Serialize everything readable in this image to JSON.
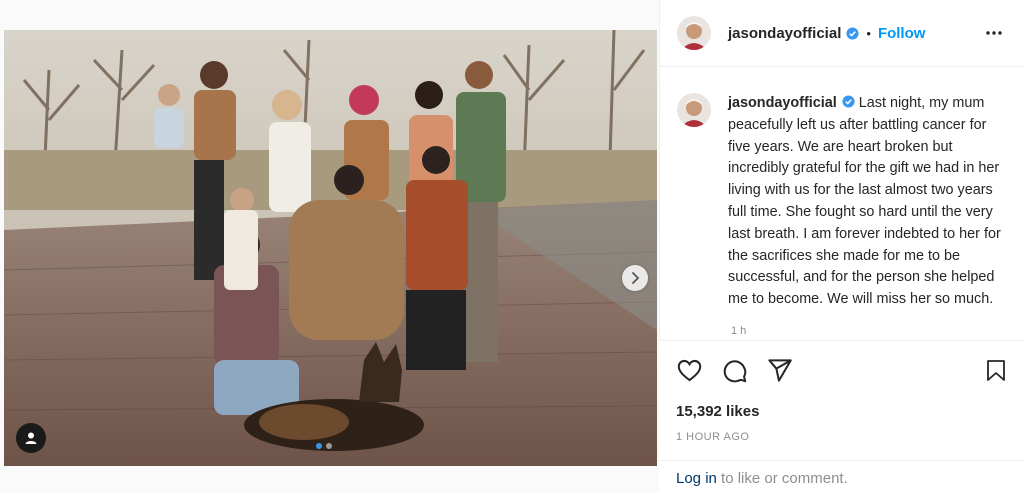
{
  "post": {
    "username": "jasondayofficial",
    "follow_label": "Follow",
    "separator": "•",
    "caption": "Last night, my mum peacefully left us after battling cancer for five years. We are heart broken but incredibly grateful for the gift we had in her living with us for the last almost two years full time. She fought so hard until the very last breath. I am forever indebted to her for the sacrifices she made for me to be successful, and for the person she helped me to become. We will miss her so much.",
    "relative_time": "1 h",
    "likes": "15,392 likes",
    "posted_ago": "1 HOUR AGO"
  },
  "login": {
    "link": "Log in",
    "rest": " to like or comment."
  },
  "carousel": {
    "slide_count": 2,
    "active_slide": 1
  },
  "icons": {
    "verified": "verified-badge-icon",
    "more": "more-options-icon",
    "like": "heart-icon",
    "comment": "comment-bubble-icon",
    "share": "paper-plane-icon",
    "save": "bookmark-icon",
    "next": "chevron-right-icon",
    "tags": "user-tag-icon"
  },
  "colors": {
    "link_blue": "#0095f6",
    "verified_blue": "#3897f0",
    "login_link": "#00376b",
    "muted": "#8e8e8e"
  }
}
